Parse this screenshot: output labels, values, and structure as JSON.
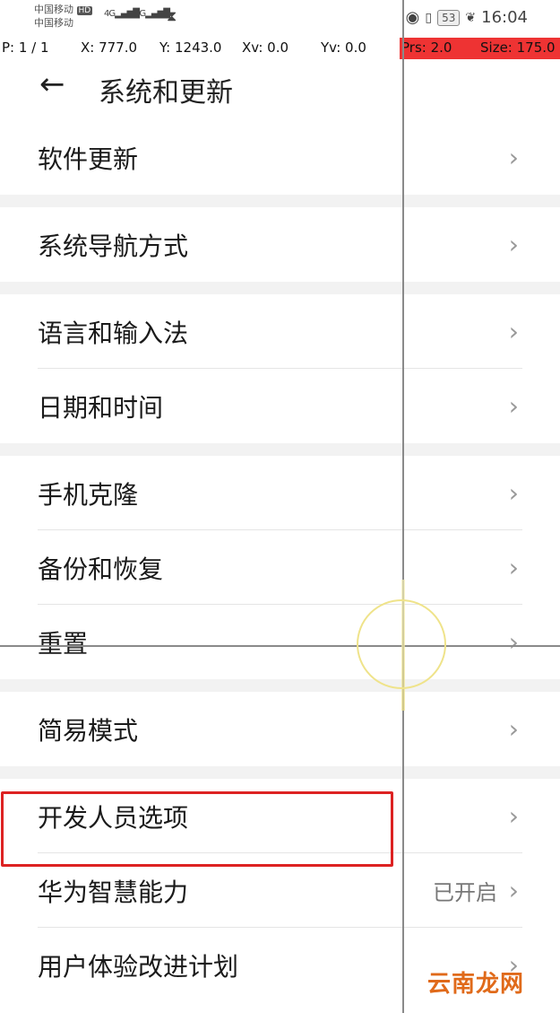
{
  "status_bar": {
    "carrier_1": "中国移动",
    "carrier_2": "中国移动",
    "hd_badge": "HD",
    "net_1": "4G",
    "net_2": "4G",
    "battery": "53",
    "time": "16:04"
  },
  "pointer_info": {
    "p": "P: 1 / 1",
    "x": "X: 777.0",
    "y": "Y: 1243.0",
    "xv": "Xv: 0.0",
    "yv": "Yv: 0.0",
    "prs": "Prs: 2.0",
    "size": "Size: 175.0"
  },
  "header": {
    "title": "系统和更新"
  },
  "menu": {
    "software_update": "软件更新",
    "navigation": "系统导航方式",
    "language": "语言和输入法",
    "datetime": "日期和时间",
    "clone": "手机克隆",
    "backup": "备份和恢复",
    "reset": "重置",
    "simple_mode": "简易模式",
    "developer": "开发人员选项",
    "huawei_ai": "华为智慧能力",
    "huawei_ai_status": "已开启",
    "ux_program": "用户体验改进计划"
  },
  "watermark": "云南龙网",
  "colors": {
    "highlight_border": "#dd2222",
    "pointer_red": "#ee3333",
    "watermark": "#e06a1a"
  }
}
